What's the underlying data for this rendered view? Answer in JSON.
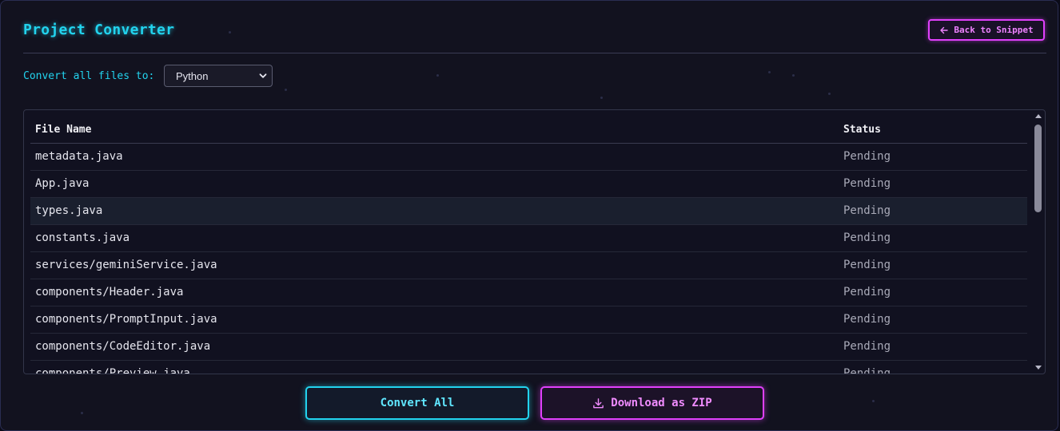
{
  "header": {
    "title": "Project Converter",
    "back_label": "Back to Snippet",
    "back_icon": "arrow-left-icon"
  },
  "convert": {
    "label": "Convert all files to:",
    "selected": "Python"
  },
  "table": {
    "columns": [
      "File Name",
      "Status"
    ],
    "rows": [
      {
        "file": "metadata.java",
        "status": "Pending"
      },
      {
        "file": "App.java",
        "status": "Pending"
      },
      {
        "file": "types.java",
        "status": "Pending"
      },
      {
        "file": "constants.java",
        "status": "Pending"
      },
      {
        "file": "services/geminiService.java",
        "status": "Pending"
      },
      {
        "file": "components/Header.java",
        "status": "Pending"
      },
      {
        "file": "components/PromptInput.java",
        "status": "Pending"
      },
      {
        "file": "components/CodeEditor.java",
        "status": "Pending"
      },
      {
        "file": "components/Preview.java",
        "status": "Pending"
      }
    ]
  },
  "actions": {
    "convert_all": "Convert All",
    "download_zip": "Download as ZIP",
    "download_icon": "download-icon"
  },
  "colors": {
    "accent_cyan": "#22d3ee",
    "accent_magenta": "#e040fb",
    "background": "#12121f"
  }
}
